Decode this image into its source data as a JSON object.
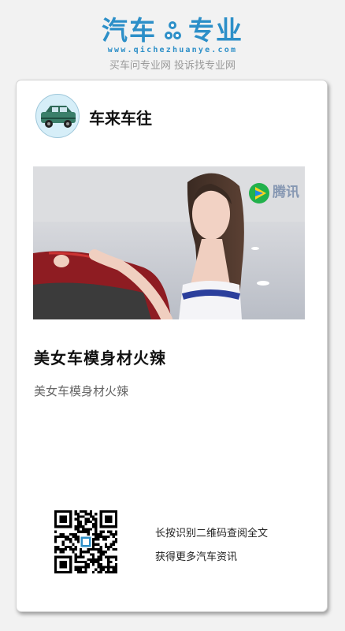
{
  "brand": {
    "name_left": "汽车",
    "name_right": "专业",
    "url": "www.qichezhuanye.com",
    "slogan": "买车问专业网 投诉找专业网"
  },
  "channel": {
    "name": "车来车往",
    "avatar_icon": "car-icon"
  },
  "article": {
    "title": "美女车模身材火辣",
    "summary": "美女车模身材火辣",
    "image_watermark": "腾讯"
  },
  "qr": {
    "line1": "长按识别二维码查阅全文",
    "line2": "获得更多汽车资讯",
    "icon": "qr-code-icon"
  },
  "colors": {
    "brand_blue": "#2c8fc8",
    "background": "#f2f2f2",
    "card": "#ffffff"
  }
}
